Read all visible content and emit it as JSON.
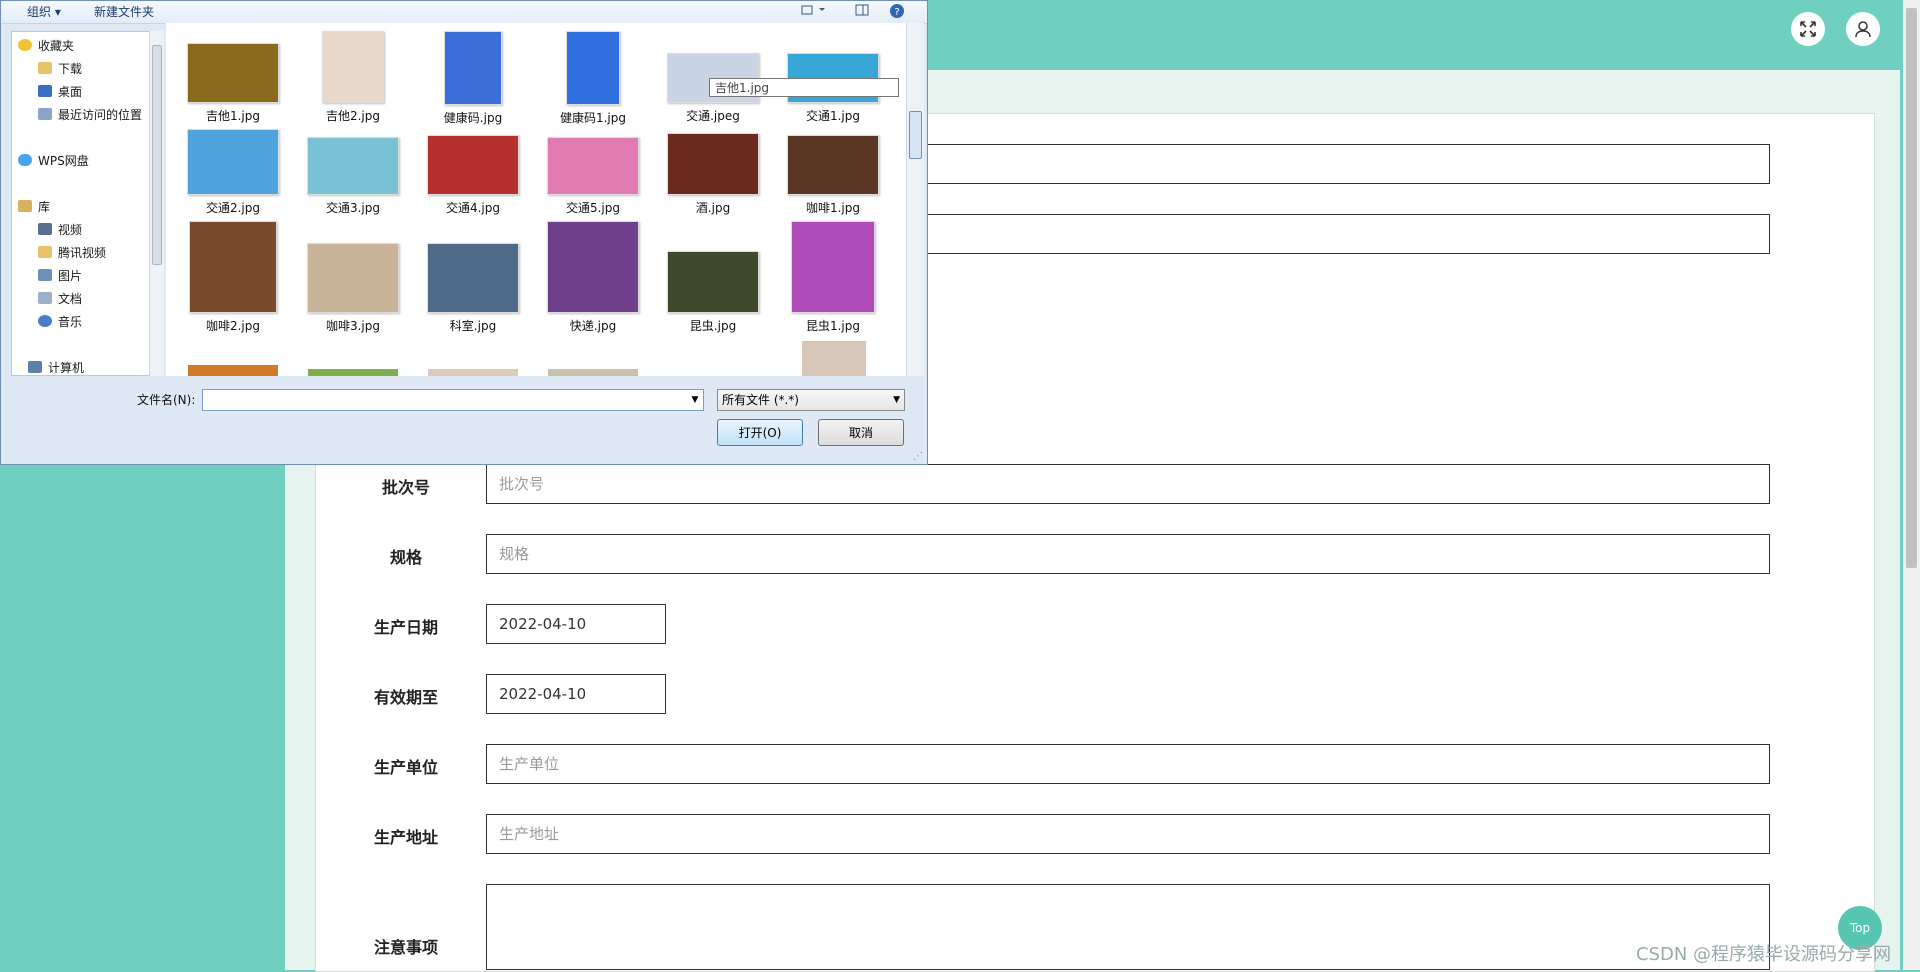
{
  "form": {
    "fields": [
      {
        "label": "批次号",
        "placeholder": "批次号",
        "value": ""
      },
      {
        "label": "规格",
        "placeholder": "规格",
        "value": ""
      },
      {
        "label": "生产日期",
        "placeholder": "",
        "value": "2022-04-10"
      },
      {
        "label": "有效期至",
        "placeholder": "",
        "value": "2022-04-10"
      },
      {
        "label": "生产单位",
        "placeholder": "生产单位",
        "value": ""
      },
      {
        "label": "生产地址",
        "placeholder": "生产地址",
        "value": ""
      },
      {
        "label": "注意事项",
        "placeholder": "",
        "value": ""
      }
    ]
  },
  "fab": {
    "top_label": "Top"
  },
  "watermark": "CSDN @程序猿毕设源码分享网",
  "dialog": {
    "toolbar": {
      "organize": "组织 ▾",
      "new_folder": "新建文件夹"
    },
    "nav": [
      {
        "label": "收藏夹",
        "icon": "star-icon"
      },
      {
        "label": "下载",
        "icon": "download-folder-icon"
      },
      {
        "label": "桌面",
        "icon": "desktop-icon"
      },
      {
        "label": "最近访问的位置",
        "icon": "recent-places-icon"
      },
      {
        "label": "WPS网盘",
        "icon": "cloud-icon"
      },
      {
        "label": "库",
        "icon": "library-icon"
      },
      {
        "label": "视频",
        "icon": "video-icon"
      },
      {
        "label": "腾讯视频",
        "icon": "folder-icon"
      },
      {
        "label": "图片",
        "icon": "pictures-icon"
      },
      {
        "label": "文档",
        "icon": "documents-icon"
      },
      {
        "label": "音乐",
        "icon": "music-icon"
      },
      {
        "label": "计算机",
        "icon": "computer-icon"
      }
    ],
    "files": [
      {
        "name": "吉他1.jpg",
        "color": "#8a6a1f"
      },
      {
        "name": "吉他2.jpg",
        "color": "#e8d8cc"
      },
      {
        "name": "健康码.jpg",
        "color": "#3b6ed6"
      },
      {
        "name": "健康码1.jpg",
        "color": "#2f6fe0"
      },
      {
        "name": "交通.jpeg",
        "color": "#c9d4e6"
      },
      {
        "name": "交通1.jpg",
        "color": "#39a6d8"
      },
      {
        "name": "交通2.jpg",
        "color": "#4fa3dd"
      },
      {
        "name": "交通3.jpg",
        "color": "#79c2d6"
      },
      {
        "name": "交通4.jpg",
        "color": "#b73030"
      },
      {
        "name": "交通5.jpg",
        "color": "#e07ab0"
      },
      {
        "name": "酒.jpg",
        "color": "#6b2a1e"
      },
      {
        "name": "咖啡1.jpg",
        "color": "#5a3624"
      },
      {
        "name": "咖啡2.jpg",
        "color": "#7a4a2c"
      },
      {
        "name": "咖啡3.jpg",
        "color": "#c9b49a"
      },
      {
        "name": "科室.jpg",
        "color": "#4e6a88"
      },
      {
        "name": "快递.jpg",
        "color": "#6e3f8a"
      },
      {
        "name": "昆虫.jpg",
        "color": "#3e4a2a"
      },
      {
        "name": "昆虫1.jpg",
        "color": "#b04ab8"
      }
    ],
    "tooltip": "吉他1.jpg",
    "filename_label": "文件名(N):",
    "filename_value": "",
    "filter": "所有文件 (*.*)",
    "open_label": "打开(O)",
    "cancel_label": "取消"
  }
}
